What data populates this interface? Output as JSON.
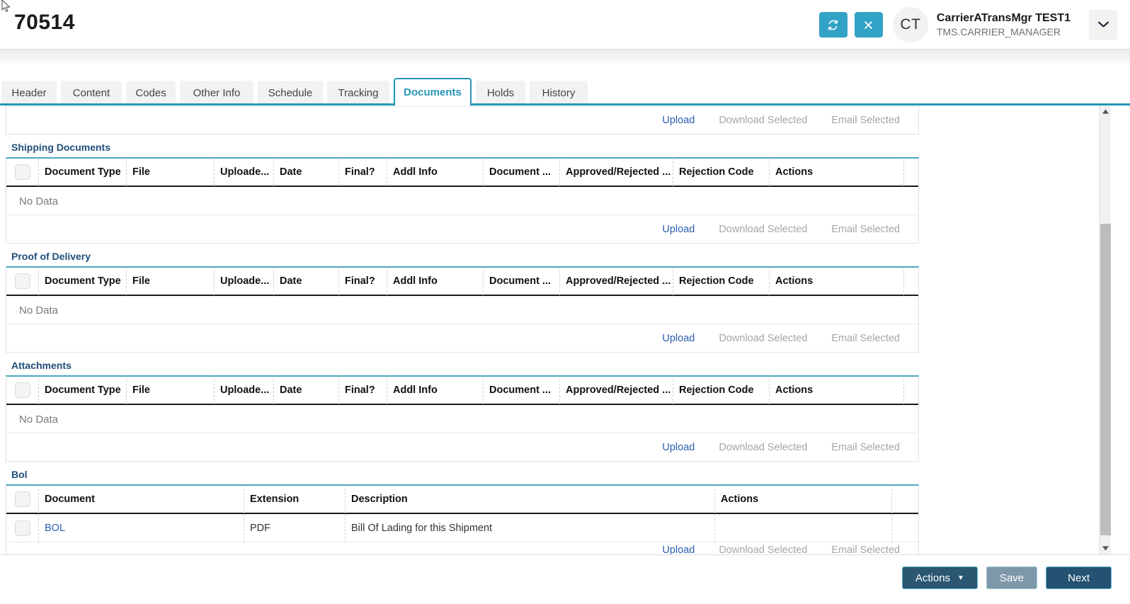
{
  "header": {
    "doc_number": "70514",
    "refresh_icon": "refresh-icon",
    "close_icon": "close-icon",
    "avatar_initials": "CT",
    "user_name": "CarrierATransMgr TEST1",
    "user_role": "TMS.CARRIER_MANAGER",
    "chevron_icon": "chevron-down-icon"
  },
  "tabs": [
    {
      "label": "Header",
      "active": false
    },
    {
      "label": "Content",
      "active": false
    },
    {
      "label": "Codes",
      "active": false
    },
    {
      "label": "Other Info",
      "active": false
    },
    {
      "label": "Schedule",
      "active": false
    },
    {
      "label": "Tracking",
      "active": false
    },
    {
      "label": "Documents",
      "active": true
    },
    {
      "label": "Holds",
      "active": false
    },
    {
      "label": "History",
      "active": false
    }
  ],
  "common": {
    "no_data": "No Data",
    "upload": "Upload",
    "download_selected": "Download Selected",
    "email_selected": "Email Selected"
  },
  "doc_columns": [
    "Document Type",
    "File",
    "Uploade...",
    "Date",
    "Final?",
    "Addl Info",
    "Document ...",
    "Approved/Rejected ...",
    "Rejection Code",
    "Actions"
  ],
  "sections": [
    {
      "title": "Shipping Documents",
      "rows": []
    },
    {
      "title": "Proof of Delivery",
      "rows": []
    },
    {
      "title": "Attachments",
      "rows": []
    }
  ],
  "bol": {
    "title": "Bol",
    "columns": [
      "Document",
      "Extension",
      "Description",
      "Actions"
    ],
    "rows": [
      {
        "document": "BOL",
        "extension": "PDF",
        "description": "Bill Of Lading for this Shipment",
        "actions": ""
      }
    ]
  },
  "footer": {
    "actions_label": "Actions",
    "save_label": "Save",
    "next_label": "Next"
  },
  "colors": {
    "accent_teal": "#2596b5",
    "icon_button": "#32a3c6",
    "section_title": "#1f4e79",
    "link_blue": "#2a5db0",
    "disabled_gray": "#a6a6a6",
    "primary_button": "#2b5773",
    "muted_button": "#7e98a9"
  }
}
